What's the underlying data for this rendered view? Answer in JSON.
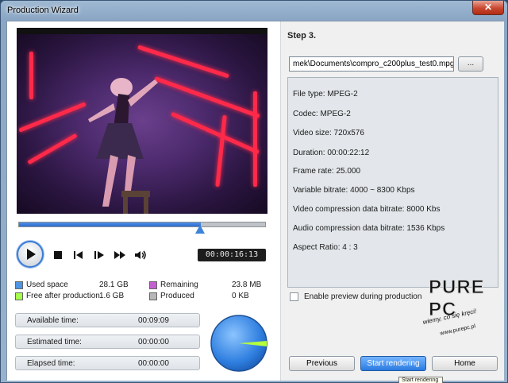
{
  "window": {
    "title": "Production Wizard",
    "close_label": "✕"
  },
  "player": {
    "progress": 0.74,
    "timecode": "00:00:16:13",
    "icons": [
      "play-icon",
      "stop-icon",
      "previous-frame-icon",
      "next-frame-icon",
      "fast-forward-icon",
      "volume-icon"
    ]
  },
  "legend": {
    "used_space": {
      "label": "Used space",
      "value": "28.1  GB",
      "color": "#4f95e3"
    },
    "free_after": {
      "label": "Free after production",
      "value": "1.6  GB",
      "color": "#a6ff4a"
    },
    "remaining": {
      "label": "Remaining",
      "value": "23.8  MB",
      "color": "#c45fd1"
    },
    "produced": {
      "label": "Produced",
      "value": "0 KB",
      "color": "#b7b7b7"
    }
  },
  "times": {
    "available": {
      "label": "Available time:",
      "value": "00:09:09"
    },
    "estimated": {
      "label": "Estimated time:",
      "value": "00:00:00"
    },
    "elapsed": {
      "label": "Elapsed time:",
      "value": "00:00:00"
    }
  },
  "step": {
    "title": "Step 3.",
    "path_value": "mek\\Documents\\compro_c200plus_test0.mpg",
    "browse_label": "...",
    "info_lines": [
      "File type: MPEG-2",
      "Codec: MPEG-2",
      "Video size: 720x576",
      "Duration: 00:00:22:12",
      "Frame rate: 25.000",
      "Variable bitrate: 4000 ~ 8300 Kbps",
      "Video compression data bitrate: 8000 Kbs",
      "Audio compression data bitrate: 1536 Kbps",
      "Aspect Ratio: 4 : 3"
    ],
    "preview_checkbox_label": "Enable preview during production",
    "preview_checked": false
  },
  "buttons": {
    "previous": "Previous",
    "start": "Start rendering",
    "home": "Home"
  },
  "watermark": {
    "logo": "PURE PC",
    "tagline": "wiemy, co się kręci!",
    "url": "www.purepc.pl"
  },
  "tooltip": "Start rendering"
}
